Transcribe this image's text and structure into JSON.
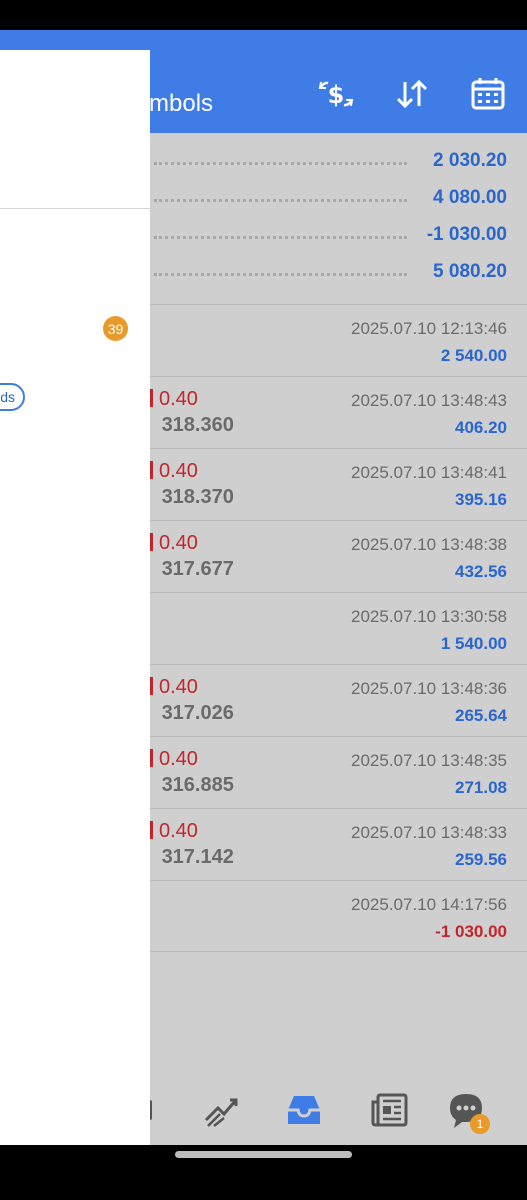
{
  "header": {
    "title": "mbols"
  },
  "summary": [
    {
      "value": "2 030.20"
    },
    {
      "value": "4 080.00"
    },
    {
      "value": "-1 030.00"
    },
    {
      "value": "5 080.20"
    }
  ],
  "rows": [
    {
      "vol": "",
      "price": "",
      "date": "2025.07.10 12:13:46",
      "amount": "2 540.00",
      "negative": false
    },
    {
      "vol": "0.40",
      "price": "318.360",
      "date": "2025.07.10 13:48:43",
      "amount": "406.20",
      "negative": false
    },
    {
      "vol": "0.40",
      "price": "318.370",
      "date": "2025.07.10 13:48:41",
      "amount": "395.16",
      "negative": false
    },
    {
      "vol": "0.40",
      "price": "317.677",
      "date": "2025.07.10 13:48:38",
      "amount": "432.56",
      "negative": false
    },
    {
      "vol": "",
      "price": "",
      "date": "2025.07.10 13:30:58",
      "amount": "1 540.00",
      "negative": false
    },
    {
      "vol": "0.40",
      "price": "317.026",
      "date": "2025.07.10 13:48:36",
      "amount": "265.64",
      "negative": false
    },
    {
      "vol": "0.40",
      "price": "316.885",
      "date": "2025.07.10 13:48:35",
      "amount": "271.08",
      "negative": false
    },
    {
      "vol": "0.40",
      "price": "317.142",
      "date": "2025.07.10 13:48:33",
      "amount": "259.56",
      "negative": false
    },
    {
      "vol": "",
      "price": "",
      "date": "2025.07.10 14:17:56",
      "amount": "-1 030.00",
      "negative": true
    }
  ],
  "drawer": {
    "badge_count": "39",
    "pill_label": "ds"
  },
  "nav": {
    "chat_badge": "1"
  },
  "colors": {
    "accent": "#3f7ce6",
    "positive": "#2a66cc",
    "negative": "#c0262c",
    "badge": "#e89a2a"
  }
}
